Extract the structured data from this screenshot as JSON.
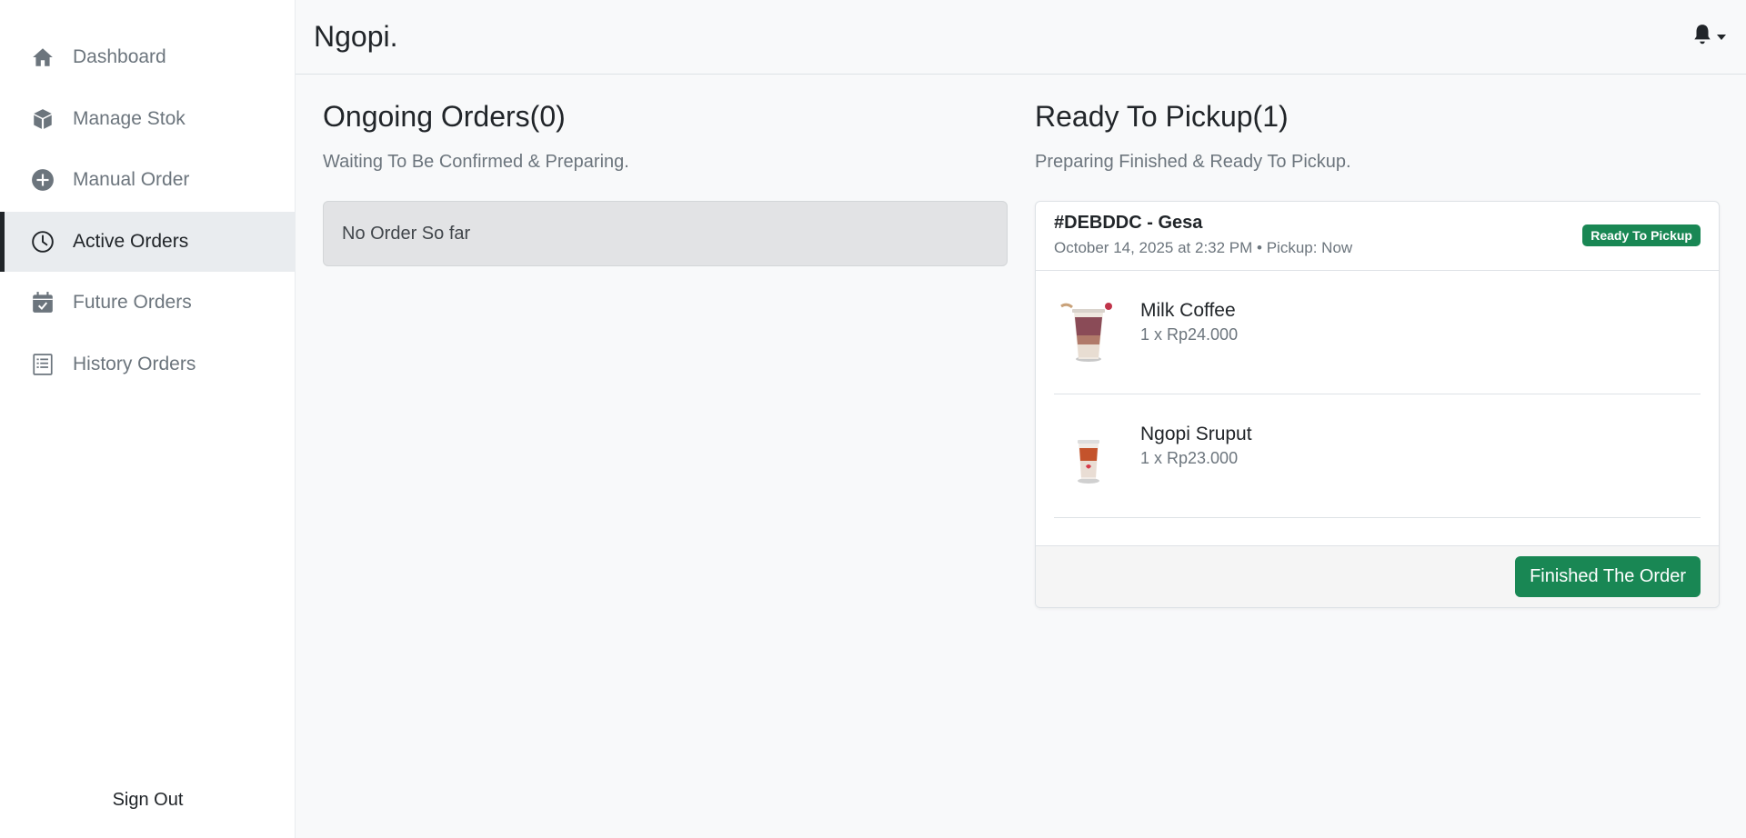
{
  "app": {
    "brand": "Ngopi."
  },
  "sidebar": {
    "items": [
      {
        "label": "Dashboard",
        "icon": "home-icon"
      },
      {
        "label": "Manage Stok",
        "icon": "box-icon"
      },
      {
        "label": "Manual Order",
        "icon": "plus-circle-icon"
      },
      {
        "label": "Active Orders",
        "icon": "clock-icon",
        "active": true
      },
      {
        "label": "Future Orders",
        "icon": "calendar-check-icon"
      },
      {
        "label": "History Orders",
        "icon": "receipt-icon"
      }
    ],
    "sign_out": "Sign Out"
  },
  "header": {
    "notification_icon": "bell-icon"
  },
  "ongoing": {
    "title": "Ongoing Orders(0)",
    "subtitle": "Waiting To Be Confirmed & Preparing.",
    "empty_text": "No Order So far"
  },
  "ready": {
    "title": "Ready To Pickup(1)",
    "subtitle": "Preparing Finished & Ready To Pickup.",
    "order": {
      "id": "#DEBDDC - Gesa",
      "meta": "October 14, 2025 at 2:32 PM • Pickup: Now",
      "badge": "Ready To Pickup",
      "items": [
        {
          "name": "Milk Coffee",
          "price": "1 x Rp24.000"
        },
        {
          "name": "Ngopi Sruput",
          "price": "1 x Rp23.000"
        }
      ],
      "action": "Finished The Order"
    }
  },
  "colors": {
    "accent": "#198754",
    "sidebar_active_bg": "#e9ecef",
    "page_bg": "#f8f9fa"
  }
}
